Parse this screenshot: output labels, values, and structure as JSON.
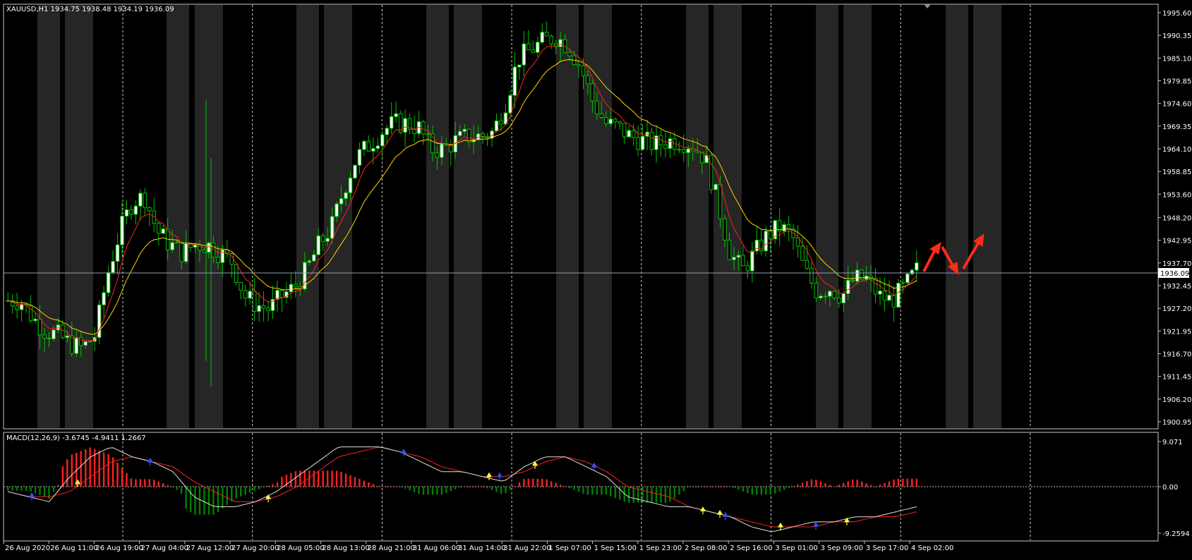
{
  "main": {
    "header": "XAUUSD,H1  1934.75 1938.48 1934.19 1936.09",
    "current_price": "1936.09",
    "price_axis": [
      "1995.60",
      "1990.35",
      "1985.10",
      "1979.85",
      "1974.60",
      "1969.35",
      "1964.10",
      "1958.85",
      "1953.60",
      "1948.20",
      "1942.95",
      "1937.70",
      "1932.45",
      "1927.20",
      "1921.95",
      "1916.70",
      "1911.45",
      "1906.20",
      "1900.95"
    ]
  },
  "macd": {
    "header": "MACD(12,26,9) -3.6745 -4.9411 1.2667",
    "axis": [
      "9.071",
      "0.00",
      "-9.2594"
    ]
  },
  "time_axis": [
    "26 Aug 2020",
    "26 Aug 11:00",
    "26 Aug 19:00",
    "27 Aug 04:00",
    "27 Aug 12:00",
    "27 Aug 20:00",
    "28 Aug 05:00",
    "28 Aug 13:00",
    "28 Aug 21:00",
    "31 Aug 06:00",
    "31 Aug 14:00",
    "31 Aug 22:00",
    "1 Sep 07:00",
    "1 Sep 15:00",
    "1 Sep 23:00",
    "2 Sep 08:00",
    "2 Sep 16:00",
    "3 Sep 01:00",
    "3 Sep 09:00",
    "3 Sep 17:00",
    "4 Sep 02:00"
  ],
  "colors": {
    "bull_candle": "#ffffff",
    "candle_outline": "#00c000",
    "ma_fast": "#ff2020",
    "ma_slow": "#ffd400",
    "macd_pos": "#ff2020",
    "macd_neg": "#008000",
    "macd_signal": "#ff2020",
    "macd_main": "#e0e0e0",
    "arrow": "#ff2a1a",
    "shade": "#262626"
  },
  "chart_data": {
    "type": "candlestick",
    "symbol": "XAUUSD",
    "timeframe": "H1",
    "ylim": [
      1900.95,
      1995.6
    ],
    "x": [
      "26 Aug 2020",
      "26 Aug 11:00",
      "26 Aug 19:00",
      "27 Aug 04:00",
      "27 Aug 12:00",
      "27 Aug 20:00",
      "28 Aug 05:00",
      "28 Aug 13:00",
      "28 Aug 21:00",
      "31 Aug 06:00",
      "31 Aug 14:00",
      "31 Aug 22:00",
      "1 Sep 07:00",
      "1 Sep 15:00",
      "1 Sep 23:00",
      "2 Sep 08:00",
      "2 Sep 16:00",
      "3 Sep 01:00",
      "3 Sep 09:00",
      "3 Sep 17:00",
      "4 Sep 02:00"
    ],
    "close_path": [
      1929,
      1929,
      1925,
      1922,
      1921,
      1919,
      1918,
      1921,
      1935,
      1945,
      1952,
      1953,
      1945,
      1942,
      1940,
      1942,
      1942,
      1940,
      1938,
      1930,
      1928,
      1927,
      1930,
      1932,
      1936,
      1942,
      1946,
      1955,
      1962,
      1965,
      1968,
      1970,
      1970,
      1969,
      1964,
      1964,
      1966,
      1967,
      1967,
      1968,
      1975,
      1985,
      1987,
      1989,
      1990,
      1988,
      1983,
      1975,
      1970,
      1969,
      1967,
      1966,
      1965,
      1966,
      1966,
      1965,
      1962,
      1952,
      1940,
      1936,
      1940,
      1944,
      1946,
      1944,
      1936,
      1931,
      1932,
      1930,
      1934,
      1934,
      1930,
      1929,
      1932,
      1936
    ],
    "high": 1992.5,
    "low": 1903.0,
    "last": 1936.09,
    "macd_main_path": [
      -1,
      -2,
      -3,
      2,
      6,
      8,
      6,
      5,
      3,
      -2,
      -4,
      -4,
      -3,
      -1,
      2,
      5,
      8,
      8,
      8,
      7,
      5,
      3,
      3,
      2,
      1,
      4,
      6,
      6,
      4,
      2,
      -2,
      -3,
      -4,
      -4,
      -5,
      -6,
      -8,
      -9,
      -8,
      -7,
      -7,
      -6,
      -6,
      -5,
      -4
    ],
    "macd_signal_path": [
      -1,
      -2,
      -2,
      -1,
      2,
      5,
      6,
      5,
      4,
      1,
      -1,
      -3,
      -3,
      -2,
      0,
      3,
      6,
      7,
      8,
      7,
      6,
      4,
      3,
      2,
      2,
      3,
      5,
      6,
      5,
      3,
      0,
      -1,
      -2,
      -4,
      -5,
      -6,
      -7,
      -8,
      -8,
      -8,
      -7,
      -7,
      -6,
      -6,
      -5
    ],
    "annotations": "red arrows projecting up, down, then up"
  }
}
